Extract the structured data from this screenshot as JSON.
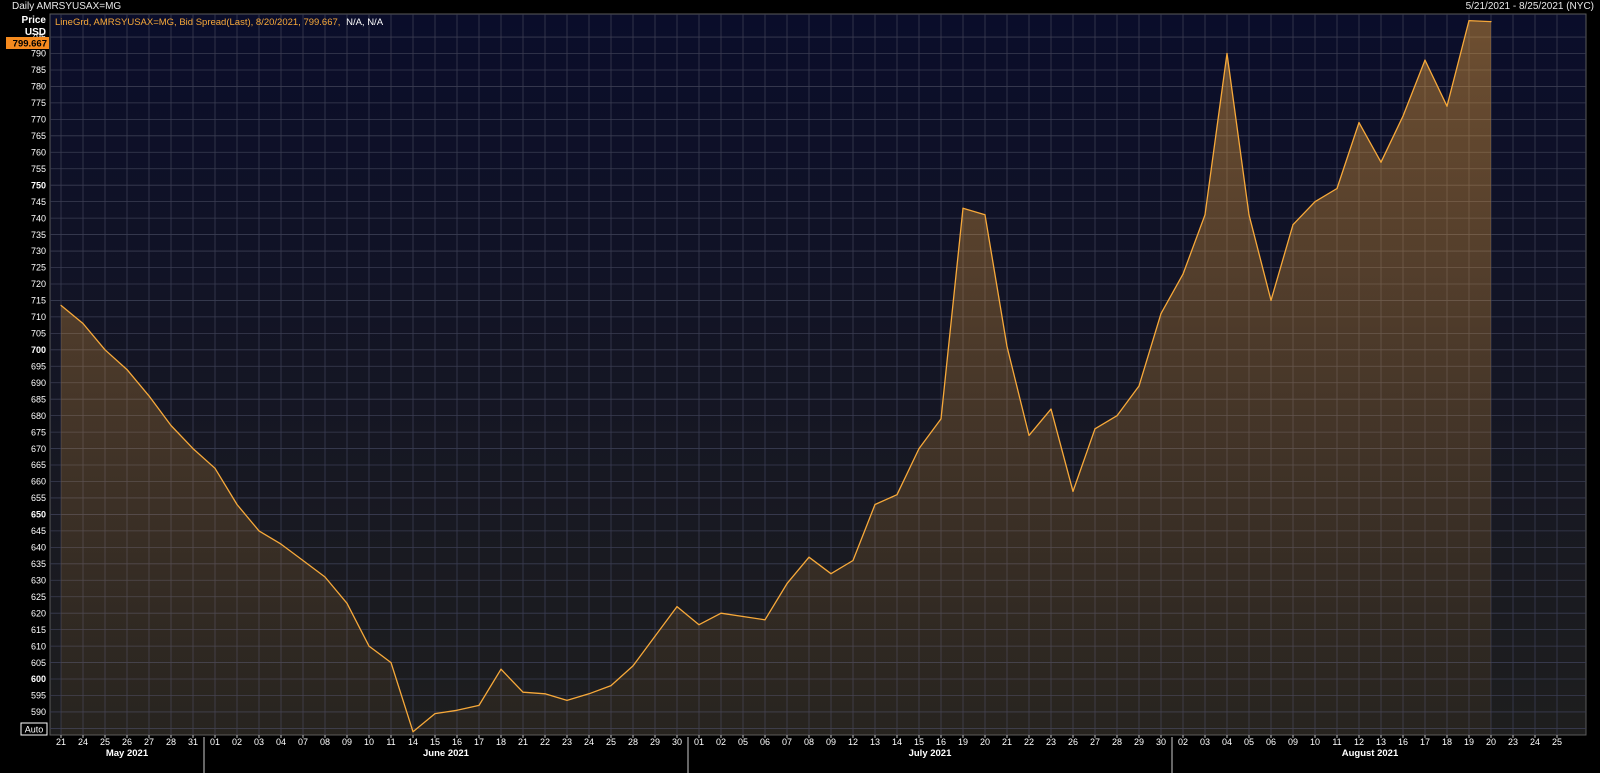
{
  "header": {
    "title": "Daily AMRSYUSAX=MG",
    "date_range": "5/21/2021 - 8/25/2021 (NYC)"
  },
  "axis": {
    "price_label": "Price",
    "currency_label": "USD",
    "last_value_tag": "799.667",
    "auto_button": "Auto"
  },
  "legend": {
    "series_text": "LineGrd, AMRSYUSAX=MG, Bid Spread(Last), 8/20/2021, 799.667,",
    "na_text": "N/A, N/A"
  },
  "colors": {
    "line": "#f7a93a",
    "background_top": "#0a0d2a",
    "background_bottom": "#1e1e1e",
    "grid": "#3a3d52",
    "tag_bg": "#f58a1e"
  },
  "chart_data": {
    "type": "area",
    "ylim": [
      583,
      802
    ],
    "y_ticks": [
      585,
      590,
      595,
      600,
      605,
      610,
      615,
      620,
      625,
      630,
      635,
      640,
      645,
      650,
      655,
      660,
      665,
      670,
      675,
      680,
      685,
      690,
      695,
      700,
      705,
      710,
      715,
      720,
      725,
      730,
      735,
      740,
      745,
      750,
      755,
      760,
      765,
      770,
      775,
      780,
      785,
      790,
      795
    ],
    "bold_ticks": [
      600,
      650,
      700,
      750
    ],
    "x_tick_labels": [
      "21",
      "24",
      "25",
      "26",
      "27",
      "28",
      "31",
      "01",
      "02",
      "03",
      "04",
      "07",
      "08",
      "09",
      "10",
      "11",
      "14",
      "15",
      "16",
      "17",
      "18",
      "21",
      "22",
      "23",
      "24",
      "25",
      "28",
      "29",
      "30",
      "01",
      "02",
      "05",
      "06",
      "07",
      "08",
      "09",
      "12",
      "13",
      "14",
      "15",
      "16",
      "19",
      "20",
      "21",
      "22",
      "23",
      "26",
      "27",
      "28",
      "29",
      "30",
      "02",
      "03",
      "04",
      "05",
      "06",
      "09",
      "10",
      "11",
      "12",
      "13",
      "16",
      "17",
      "18",
      "19",
      "20",
      "23",
      "24",
      "25"
    ],
    "months": [
      {
        "label": "May 2021",
        "start": 0
      },
      {
        "label": "June 2021",
        "start": 7
      },
      {
        "label": "July 2021",
        "start": 29
      },
      {
        "label": "August 2021",
        "start": 51
      }
    ],
    "series": [
      {
        "values": [
          713.5,
          708,
          700,
          694,
          686,
          677,
          670,
          664,
          653,
          645,
          641,
          636,
          631,
          623,
          610,
          605,
          584,
          589.5,
          590.5,
          592,
          603,
          596,
          595.5,
          593.5,
          595.5,
          598,
          604,
          613,
          622,
          616.5,
          620,
          619,
          618,
          629,
          637,
          632,
          636,
          653,
          656,
          670,
          679,
          743,
          741,
          701,
          674,
          682,
          657,
          676,
          680,
          689,
          711,
          723,
          741,
          790,
          741,
          715,
          738,
          745,
          749,
          769,
          757,
          771,
          788,
          774,
          800,
          799.7
        ]
      }
    ]
  }
}
